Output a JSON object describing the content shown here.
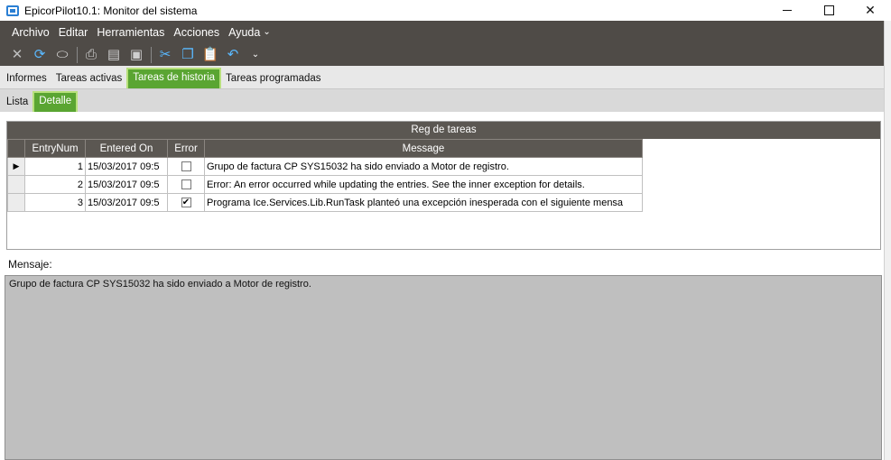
{
  "window": {
    "title": "EpicorPilot10.1: Monitor del sistema",
    "controls": {
      "minimize": "",
      "maximize": "",
      "close": "✕"
    }
  },
  "menu": {
    "items": [
      "Archivo",
      "Editar",
      "Herramientas",
      "Acciones",
      "Ayuda"
    ],
    "overflow": "⌄"
  },
  "toolbar": {
    "icons": [
      {
        "name": "delete-icon",
        "glyph": "✕",
        "color": "#bfbfbf"
      },
      {
        "name": "refresh-icon",
        "glyph": "⟳",
        "color": "#5ab9ff"
      },
      {
        "name": "eraser-icon",
        "glyph": "⬭",
        "color": "#e0e0e0"
      },
      {
        "name": "print-icon",
        "glyph": "⎙",
        "color": "#cfcfcf"
      },
      {
        "name": "print-preview-icon",
        "glyph": "▤",
        "color": "#cfcfcf"
      },
      {
        "name": "save-icon",
        "glyph": "▣",
        "color": "#cfcfcf"
      },
      {
        "name": "cut-icon",
        "glyph": "✂",
        "color": "#5ab9ff"
      },
      {
        "name": "copy-icon",
        "glyph": "❐",
        "color": "#5ab9ff"
      },
      {
        "name": "paste-icon",
        "glyph": "📋",
        "color": "#f0f0f0"
      },
      {
        "name": "undo-icon",
        "glyph": "↶",
        "color": "#5ab9ff"
      }
    ],
    "overflow": "⌄"
  },
  "tabs_main": [
    {
      "label": "Informes",
      "active": false
    },
    {
      "label": "Tareas activas",
      "active": false
    },
    {
      "label": "Tareas de historia",
      "active": true
    },
    {
      "label": "Tareas programadas",
      "active": false
    }
  ],
  "tabs_sub": [
    {
      "label": "Lista",
      "active": false
    },
    {
      "label": "Detalle",
      "active": true
    }
  ],
  "grid": {
    "caption": "Reg de tareas",
    "columns": [
      "EntryNum",
      "Entered On",
      "Error",
      "Message"
    ],
    "rows": [
      {
        "selected": true,
        "entry_num": "1",
        "entered_on": "15/03/2017 09:5",
        "error": false,
        "message": "Grupo de factura CP SYS15032  ha sido enviado a Motor de registro."
      },
      {
        "selected": false,
        "entry_num": "2",
        "entered_on": "15/03/2017 09:5",
        "error": false,
        "message": "Error: An error occurred while updating the entries. See the inner exception for details."
      },
      {
        "selected": false,
        "entry_num": "3",
        "entered_on": "15/03/2017 09:5",
        "error": true,
        "message": "Programa Ice.Services.Lib.RunTask planteó una excepción inesperada con el siguiente mensa"
      }
    ],
    "row_pointer": "▶"
  },
  "message_panel": {
    "label": "Mensaje:",
    "text": "Grupo de factura CP SYS15032  ha sido enviado a Motor de registro."
  },
  "colors": {
    "accent_green": "#5aa532",
    "menu_bar": "#4f4b47",
    "grid_header": "#5b5752"
  }
}
